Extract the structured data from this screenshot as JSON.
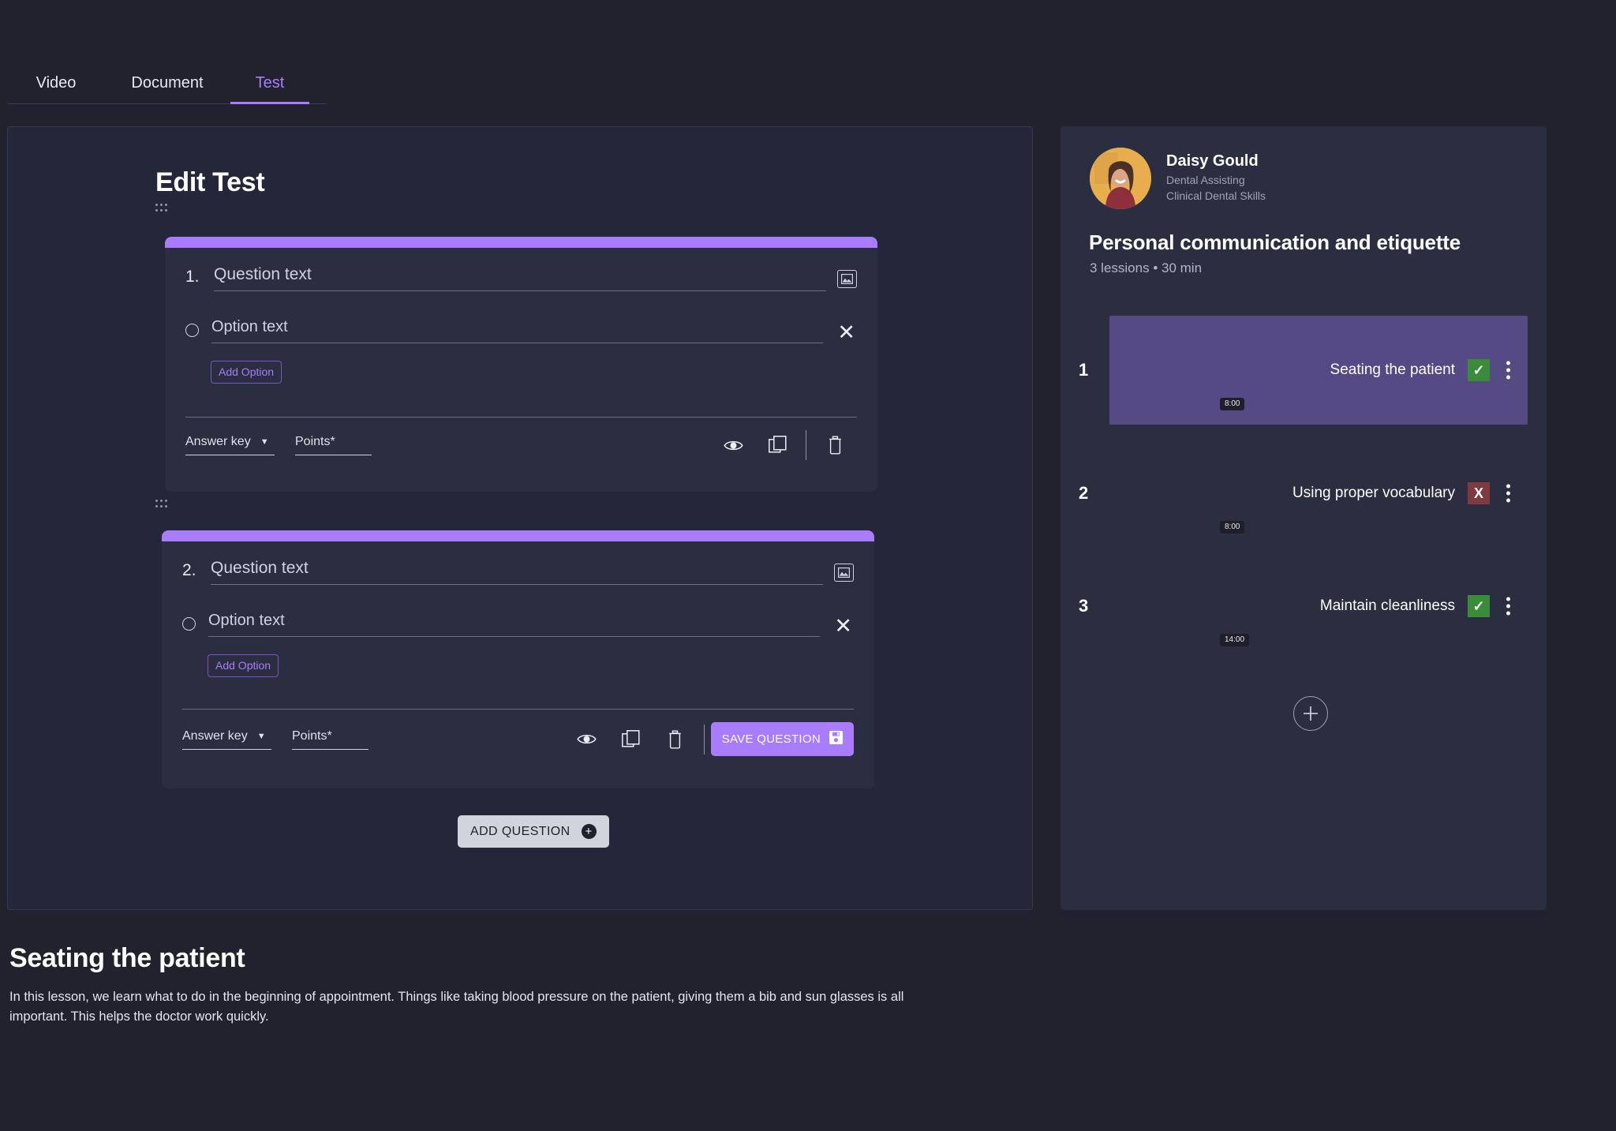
{
  "tabs": [
    {
      "label": "Video",
      "active": false
    },
    {
      "label": "Document",
      "active": false
    },
    {
      "label": "Test",
      "active": true
    }
  ],
  "editor": {
    "title": "Edit Test",
    "add_question_label": "ADD QUESTION",
    "questions": [
      {
        "number": "1.",
        "question_placeholder": "Question text",
        "option_placeholder": "Option text",
        "add_option_label": "Add Option",
        "answer_key_label": "Answer key",
        "points_label": "Points*",
        "has_save": false
      },
      {
        "number": "2.",
        "question_placeholder": "Question text",
        "option_placeholder": "Option text",
        "add_option_label": "Add Option",
        "answer_key_label": "Answer key",
        "points_label": "Points*",
        "has_save": true,
        "save_label": "SAVE QUESTION"
      }
    ]
  },
  "sidebar": {
    "teacher": {
      "name": "Daisy Gould",
      "subject": "Dental Assisting",
      "program": "Clinical Dental Skills"
    },
    "course_title": "Personal communication and etiquette",
    "course_meta": "3 lessions • 30 min",
    "lessons": [
      {
        "index": "1",
        "title": "Seating the patient",
        "duration": "8:00",
        "status": "ok",
        "status_glyph": "✓",
        "selected": true
      },
      {
        "index": "2",
        "title": "Using proper vocabulary",
        "duration": "8:00",
        "status": "no",
        "status_glyph": "X",
        "selected": false
      },
      {
        "index": "3",
        "title": "Maintain cleanliness",
        "duration": "14:00",
        "status": "ok",
        "status_glyph": "✓",
        "selected": false
      }
    ]
  },
  "detail": {
    "heading": "Seating the patient",
    "description": "In this lesson, we learn what to do in the beginning of appointment.  Things like taking blood pressure on the patient, giving them a bib and sun glasses is all important.  This helps the doctor work quickly."
  },
  "colors": {
    "accent_purple": "#a87cfc",
    "selected_lesson": "#564a84",
    "status_ok": "#3a8c3a",
    "status_no": "#7e3b3f",
    "page_bg": "#21222e",
    "panel_bg": "#24263a",
    "card_bg": "#2b2e40"
  }
}
